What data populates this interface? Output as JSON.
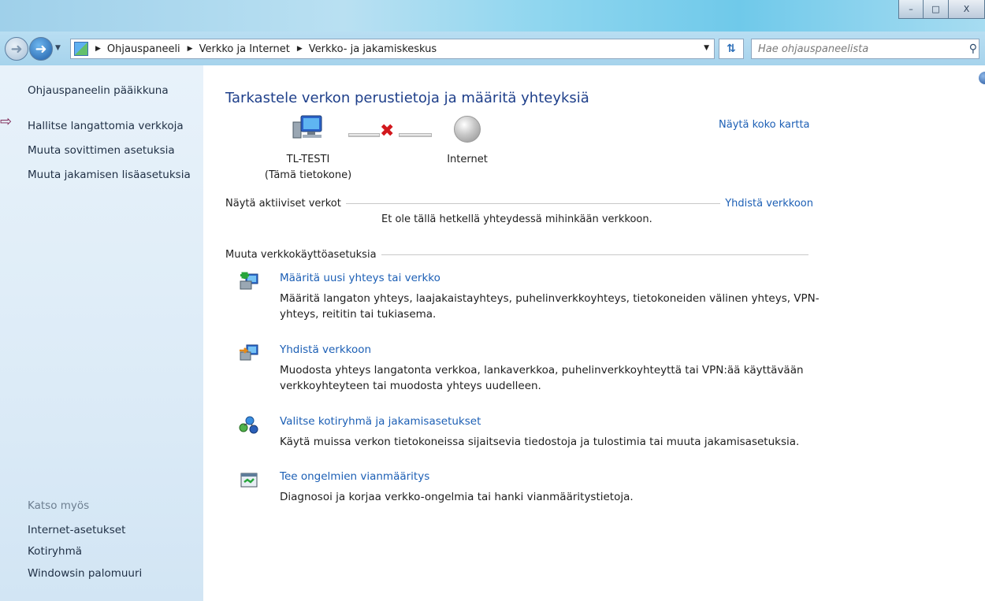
{
  "window": {
    "controls": {
      "minimize": "–",
      "maximize": "□",
      "close": "X"
    }
  },
  "address": {
    "breadcrumbs": [
      "Ohjauspaneeli",
      "Verkko ja Internet",
      "Verkko- ja jakamiskeskus"
    ],
    "search_placeholder": "Hae ohjauspaneelista"
  },
  "sidebar": {
    "links": [
      "Ohjauspaneelin pääikkuna",
      "Hallitse langattomia verkkoja",
      "Muuta sovittimen asetuksia",
      "Muuta jakamisen lisäasetuksia"
    ],
    "see_also_title": "Katso myös",
    "see_also": [
      "Internet-asetukset",
      "Kotiryhmä",
      "Windowsin palomuuri"
    ]
  },
  "main": {
    "title": "Tarkastele verkon perustietoja ja määritä yhteyksiä",
    "map_link": "Näytä koko kartta",
    "computer_name": "TL-TESTI",
    "computer_sub": "(Tämä tietokone)",
    "internet_label": "Internet",
    "active_networks_label": "Näytä aktiiviset verkot",
    "connect_link": "Yhdistä verkkoon",
    "not_connected": "Et ole tällä hetkellä yhteydessä mihinkään verkkoon.",
    "change_settings_label": "Muuta verkkokäyttöasetuksia",
    "tasks": [
      {
        "title": "Määritä uusi yhteys tai verkko",
        "desc": "Määritä langaton yhteys, laajakaistayhteys, puhelinverkkoyhteys, tietokoneiden välinen yhteys, VPN-yhteys, reititin tai tukiasema.",
        "icon": "new-connection-icon"
      },
      {
        "title": "Yhdistä verkkoon",
        "desc": "Muodosta yhteys langatonta verkkoa, lankaverkkoa, puhelinverkkoyhteyttä tai VPN:ää käyttävään verkkoyhteyteen tai muodosta yhteys uudelleen.",
        "icon": "connect-network-icon"
      },
      {
        "title": "Valitse kotiryhmä ja jakamisasetukset",
        "desc": "Käytä muissa verkon tietokoneissa sijaitsevia tiedostoja ja tulostimia tai muuta jakamisasetuksia.",
        "icon": "homegroup-icon"
      },
      {
        "title": "Tee ongelmien vianmääritys",
        "desc": "Diagnosoi ja korjaa verkko-ongelmia tai hanki vianmääritystietoja.",
        "icon": "troubleshoot-icon"
      }
    ]
  },
  "colors": {
    "link": "#1c5fb5",
    "title": "#1e3f8a",
    "sidebar_bg": "#dcebf7",
    "error_x": "#d2181d"
  }
}
